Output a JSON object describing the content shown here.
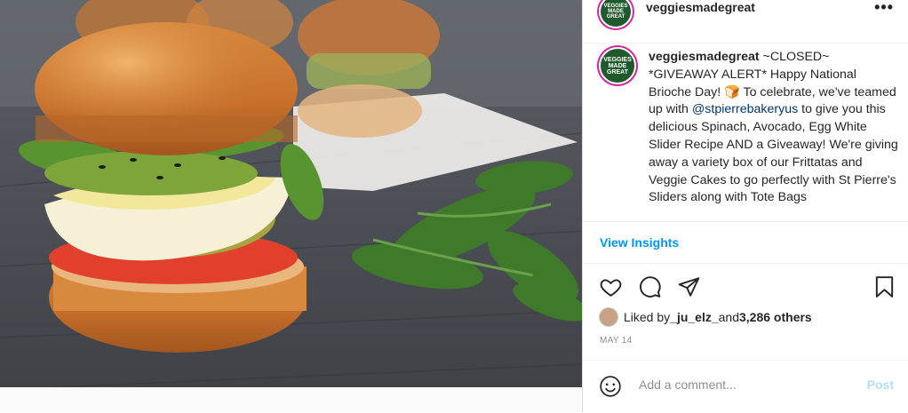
{
  "post": {
    "username": "veggiesmadegreat",
    "avatar_text": "VEGGIES MADE GREAT",
    "caption_text": " ~CLOSED~ *GIVEAWAY ALERT* Happy National Brioche Day! 🍞 To celebrate, we've teamed up with ",
    "caption_mention": "@stpierrebakeryus",
    "caption_rest": " to give you this delicious Spinach, Avocado, Egg White Slider Recipe AND a Giveaway! We're giving away a variety box of our Frittatas and Veggie Cakes to go perfectly with St Pierre's Sliders along with Tote Bags",
    "view_insights": "View Insights",
    "liked_by_prefix": "Liked by ",
    "liked_by_user": "_ju_elz_",
    "liked_by_and": " and ",
    "liked_by_others": "3,286 others",
    "date": "MAY 14",
    "comment_placeholder": "Add a comment...",
    "post_button": "Post",
    "more_label": "•••"
  },
  "icons": {
    "like": "heart-icon",
    "comment": "comment-icon",
    "share": "share-icon",
    "save": "bookmark-icon",
    "emoji": "emoji-icon",
    "more": "more-icon"
  },
  "colors": {
    "link": "#00376b",
    "insights": "#0095f6",
    "post_disabled": "#b2dffc",
    "muted": "#8e8e8e"
  }
}
